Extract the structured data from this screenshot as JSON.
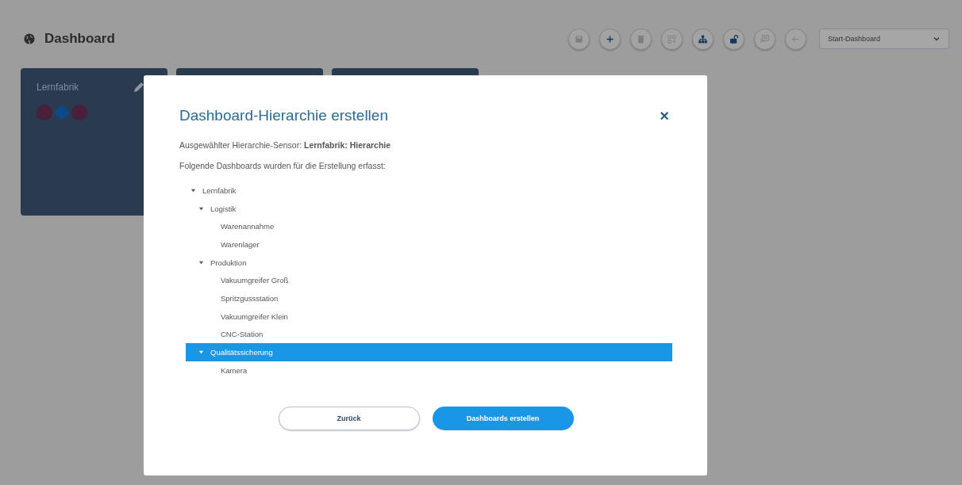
{
  "header": {
    "title": "Dashboard"
  },
  "toolbar": [
    {
      "kind": "save",
      "disabled": true
    },
    {
      "kind": "add",
      "disabled": false
    },
    {
      "kind": "delete",
      "disabled": true
    },
    {
      "kind": "widgets",
      "disabled": true
    },
    {
      "kind": "hierarchy",
      "disabled": false
    },
    {
      "kind": "lock",
      "disabled": false
    },
    {
      "kind": "comment",
      "disabled": true
    },
    {
      "kind": "back",
      "disabled": true
    }
  ],
  "dashboard_select": {
    "value": "Start-Dashboard"
  },
  "cards": [
    {
      "kind": "dashboard",
      "title": "Lernfabrik",
      "markers": [
        {
          "kind": "circle",
          "color": "#4a1f3a"
        },
        {
          "kind": "diamond",
          "color": "#0a4a8a"
        },
        {
          "kind": "circle",
          "color": "#4a1f3a"
        }
      ]
    },
    {
      "kind": "dashboard"
    },
    {
      "kind": "dashboard"
    }
  ],
  "dialog": {
    "title": "Dashboard-Hierarchie erstellen",
    "close": "×",
    "sensor_line": "Ausgewählter Hierarchie-Sensor: **Lernfabrik: Hierarchie**",
    "intro": "Folgende Dashboards wurden für die Erstellung erfasst:",
    "tree": [
      {
        "label": "Lernfabrik",
        "expanded": true,
        "selected": false,
        "children": [
          {
            "label": "Logistik",
            "expanded": true,
            "selected": false,
            "children": [
              {
                "label": "Warenannahme",
                "selected": false
              },
              {
                "label": "Warenlager",
                "selected": false
              }
            ]
          },
          {
            "label": "Produktion",
            "expanded": true,
            "selected": false,
            "children": [
              {
                "label": "Vakuumgreifer Groß",
                "selected": false
              },
              {
                "label": "Spritzgussstation",
                "selected": false
              },
              {
                "label": "Vakuumgreifer Klein",
                "selected": false
              },
              {
                "label": "CNC-Station",
                "selected": false
              }
            ]
          },
          {
            "label": "Qualitätssicherung",
            "expanded": true,
            "selected": true,
            "children": [
              {
                "label": "Kamera",
                "selected": false
              }
            ]
          }
        ]
      }
    ],
    "buttons": [
      {
        "label": "Zurück",
        "kind": "secondary"
      },
      {
        "label": "Dashboards erstellen",
        "kind": "primary"
      }
    ]
  }
}
